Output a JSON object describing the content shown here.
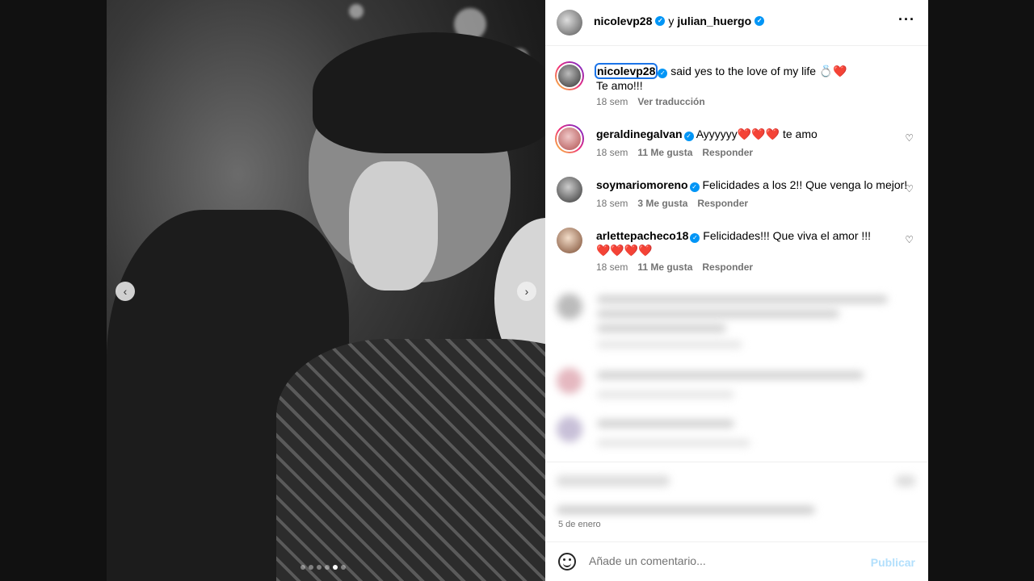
{
  "header": {
    "user1": "nicolevp28",
    "connector": "y",
    "user2": "julian_huergo",
    "more_icon": "more-horizontal-icon"
  },
  "caption": {
    "user": "nicolevp28",
    "text": " said yes to the love of my life 💍❤️",
    "line2": "Te amo!!!",
    "time": "18 sem",
    "translate": "Ver traducción"
  },
  "comments": [
    {
      "user": "geraldinegalvan",
      "text": " Ayyyyyy❤️❤️❤️ te amo",
      "time": "18 sem",
      "likes": "11 Me gusta",
      "reply": "Responder"
    },
    {
      "user": "soymariomoreno",
      "text": " Felicidades a los 2!! Que venga lo mejor!",
      "time": "18 sem",
      "likes": "3 Me gusta",
      "reply": "Responder"
    },
    {
      "user": "arlettepacheco18",
      "text": " Felicidades!!! Que viva el amor !!!",
      "line2": "❤️❤️❤️❤️",
      "time": "18 sem",
      "likes": "11 Me gusta",
      "reply": "Responder"
    }
  ],
  "date": "5 de enero",
  "add_comment": {
    "placeholder": "Añade un comentario...",
    "publish": "Publicar"
  },
  "colors": {
    "verified": "#0095f6",
    "publish": "#b2dffc",
    "muted": "#737373"
  }
}
